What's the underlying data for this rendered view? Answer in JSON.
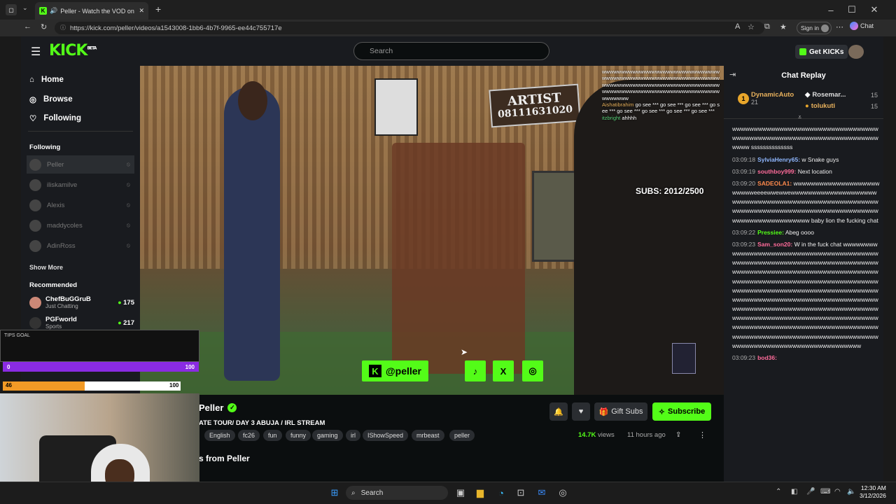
{
  "browser": {
    "tab_title": "Peller - Watch the VOD on Ki",
    "url": "https://kick.com/peller/videos/a1543008-1bb6-4b7f-9965-ee44c755717e",
    "sign_in": "Sign in",
    "chat": "Chat",
    "new_tab": "+"
  },
  "kick": {
    "logo": "KICK",
    "logo_beta": "BETA",
    "search_placeholder": "Search",
    "get_kicks": "Get KICKs",
    "nav": [
      {
        "label": "Home",
        "icon": "home-icon"
      },
      {
        "label": "Browse",
        "icon": "compass-icon"
      },
      {
        "label": "Following",
        "icon": "heart-icon"
      }
    ],
    "following_label": "Following",
    "following": [
      "Peller",
      "iliskamilve",
      "Alexis",
      "maddycoles",
      "AdinRoss"
    ],
    "show_more": "Show More",
    "recommended_label": "Recommended",
    "recommended": [
      {
        "name": "ChefBuGGruB",
        "category": "Just Chatting",
        "viewers": "175"
      },
      {
        "name": "PGFworld",
        "category": "Sports",
        "viewers": "217"
      }
    ],
    "video": {
      "subs": "SUBS: 2012/2500",
      "handle": "@peller",
      "artist_sign": "ARTIST",
      "artist_phone": "08111631020",
      "overlay_chat": [
        {
          "user": "",
          "text": "wwwwwwwwwwwwwwwwwwwwwwwwwwwwwwwwwwwwwwwwwwwwwwwwwwwwwwwwwwwwwwwwwwwwwwwwwwwwwwwwwwwwwwwwwwwwwwwwwwwwwwwwwwwwwwwwwwwwwwwwwwwwwwwwwww"
        },
        {
          "user": "Aishatibrahim",
          "text": "go see *** go see *** go see *** go see *** go see *** go see *** go see *** go see ***"
        },
        {
          "user": "itzbright",
          "text": "ahhhh"
        }
      ]
    },
    "streamer": "Peller",
    "stream_title": "ATE TOUR/ DAY 3 ABUJA / IRL STREAM",
    "tags": [
      "English",
      "fc26",
      "fun",
      "funny",
      "gaming",
      "irl",
      "IShowSpeed",
      "mrbeast",
      "peller"
    ],
    "views": "14.7K",
    "views_label": "views",
    "ago": "11 hours ago",
    "gift_subs": "Gift Subs",
    "subscribe": "Subscribe",
    "more_from": "s from Peller",
    "chat": {
      "title": "Chat Replay",
      "pinned": [
        {
          "rank": "1",
          "name": "DynamicAuto",
          "count": "21"
        },
        {
          "name": "Rosemar...",
          "count": "15"
        },
        {
          "name": "tolukuti",
          "count": "15"
        }
      ],
      "messages": [
        {
          "ts": "",
          "user": "",
          "color": "#fff",
          "text": "wwwwwwwwwwwwwwwwwwwwwwwwwwwwwwwwwwwwwwwwwwwwwwwwwwwwwwwwwwwwwwwwwwwwwwww ssssssssssssss"
        },
        {
          "ts": "03:09:18",
          "user": "SylviaHenry65:",
          "color": "#8fb7ff",
          "text": "w Snake guys"
        },
        {
          "ts": "03:09:19",
          "user": "southboy999:",
          "color": "#ff6b9a",
          "text": "Next location"
        },
        {
          "ts": "03:09:20",
          "user": "SADEOLA1:",
          "color": "#ff8a4c",
          "text": "wwwwwwwwwwwwwwwwwwwwwwwwweeeewwewwewwwwwwwwwwwwwwwwwwwwwwwwwwwwwwwwwwwwwwwwwwwwwwwwwwwwwwwwwwwwwwwwwwwwwwwwwwwwwwwwwwwwwwwwwwwwwwwwwwwwwwwwww baby lion the fucking chat"
        },
        {
          "ts": "03:09:22",
          "user": "Pressiee:",
          "color": "#53fc18",
          "text": "Abeg oooo"
        },
        {
          "ts": "03:09:23",
          "user": "Sam_son20:",
          "color": "#ff6b9a",
          "text": "W in the fuck chat wwwwwwwwwwwwwwwwwwwwwwwwwwwwwwwwwwwwwwwwwwwwwwwwwwwwwwwwwwwwwwwwwwwwwwwwwwwwwwwwwwwwwwwwwwwwwwwwwwwwwwwwwwwwwwwwwwwwwwwwwwwwwwwwwwwwwwwwwwwwwwwwwwwwwwwwwwwwwwwwwwwwwwwwwwwwwwwwwwwwwwwwwwwwwwwwwwwwwwwwwwwwwwwwwwwwwwwwwwwwwwwwwwwwwwwwwwwwwwwwwwwwwwwwwwwwwwwwwwwwwwwwwwwwwwwwwwwwwwwwwwwwwwwwwwwwwwwwwwwwwwwwwwwwwwwwwwwwwwwwwwwwwwwwwwwwwwwwwwwwwwwwwwwwwwwwwwwwwwwwwwwwwwwwwwwwwwwwww"
        },
        {
          "ts": "03:09:23",
          "user": "bod36:",
          "color": "#ff6b9a",
          "text": ""
        }
      ]
    }
  },
  "overlay": {
    "tips_goal": "TIPS GOAL",
    "bar1_left": "0",
    "bar1_right": "100",
    "bar2_left": "46",
    "bar2_right": "100",
    "bar2_progress": 0.46
  },
  "taskbar": {
    "search": "Search",
    "time": "12:30 AM",
    "date": "3/12/2026"
  }
}
